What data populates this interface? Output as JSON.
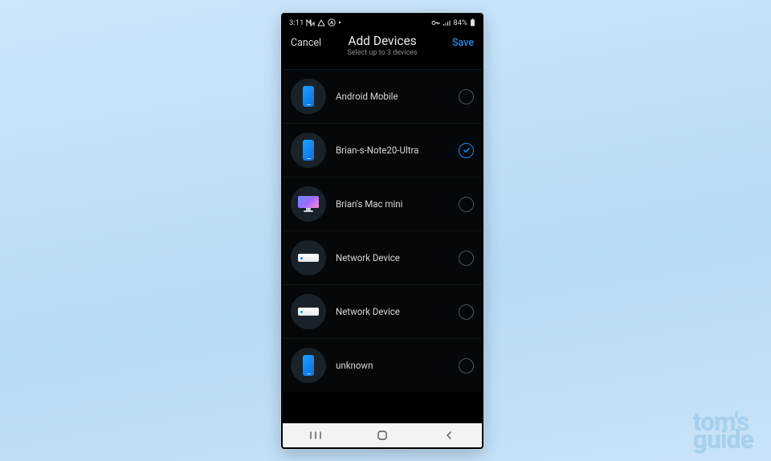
{
  "branding": {
    "watermark_line1": "tom's",
    "watermark_line2": "guide"
  },
  "statusbar": {
    "time": "3:11",
    "battery_text": "84%"
  },
  "header": {
    "cancel_label": "Cancel",
    "save_label": "Save",
    "title": "Add Devices",
    "subtitle": "Select up to 3 devices"
  },
  "devices": [
    {
      "name": "Android Mobile",
      "icon": "phone",
      "selected": false
    },
    {
      "name": "Brian-s-Note20-Ultra",
      "icon": "phone",
      "selected": true
    },
    {
      "name": "Brian's Mac mini",
      "icon": "monitor",
      "selected": false
    },
    {
      "name": "Network Device",
      "icon": "box",
      "selected": false
    },
    {
      "name": "Network Device",
      "icon": "box",
      "selected": false
    },
    {
      "name": "unknown",
      "icon": "phone",
      "selected": false
    }
  ]
}
